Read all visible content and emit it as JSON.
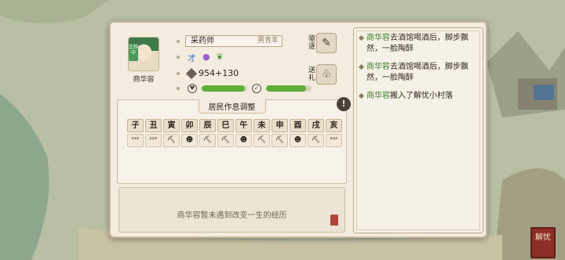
{
  "character": {
    "name": "商华容",
    "work_tag": "工作中",
    "job": "采药师",
    "job_subtitle": "男青年",
    "money": "954+130",
    "stamina_fraction": 0.95,
    "mood_fraction": 0.88,
    "traits": [
      "才",
      "egg-icon",
      "leaf-icon"
    ]
  },
  "actions": {
    "expel_label": "驱逐",
    "gift_label": "送礼"
  },
  "schedule": {
    "title": "居民作息调整",
    "warn_icon": "!",
    "hours": [
      {
        "label": "子",
        "activity": "ᶻᶻᶻ",
        "icon": "sleep-icon"
      },
      {
        "label": "丑",
        "activity": "ᶻᶻᶻ",
        "icon": "sleep-icon"
      },
      {
        "label": "寅",
        "activity": "⛏",
        "icon": "work-icon"
      },
      {
        "label": "卯",
        "activity": "☻",
        "icon": "leisure-icon"
      },
      {
        "label": "辰",
        "activity": "⛏",
        "icon": "work-icon"
      },
      {
        "label": "巳",
        "activity": "⛏",
        "icon": "work-icon"
      },
      {
        "label": "午",
        "activity": "☻",
        "icon": "leisure-icon"
      },
      {
        "label": "未",
        "activity": "⛏",
        "icon": "work-icon"
      },
      {
        "label": "申",
        "activity": "⛏",
        "icon": "work-icon"
      },
      {
        "label": "酉",
        "activity": "☻",
        "icon": "leisure-icon"
      },
      {
        "label": "戌",
        "activity": "⛏",
        "icon": "work-icon"
      },
      {
        "label": "亥",
        "activity": "ᶻᶻᶻ",
        "icon": "sleep-icon"
      }
    ]
  },
  "fate": {
    "text": "商华容暂未遇到改变一生的经历"
  },
  "log": [
    {
      "name": "商华容",
      "text": "去酒馆喝酒后，脚步飘然，一脸陶醉"
    },
    {
      "name": "商华容",
      "text": "去酒馆喝酒后，脚步飘然，一脸陶醉"
    },
    {
      "name": "商华容",
      "text": "搬入了解忧小村落"
    }
  ],
  "corner_seal": "解忧",
  "colors": {
    "accent_green": "#5fae3b",
    "name_green": "#3d7a2c",
    "panel_bg": "#f3ecdf",
    "seal_red": "#8c2f27"
  }
}
